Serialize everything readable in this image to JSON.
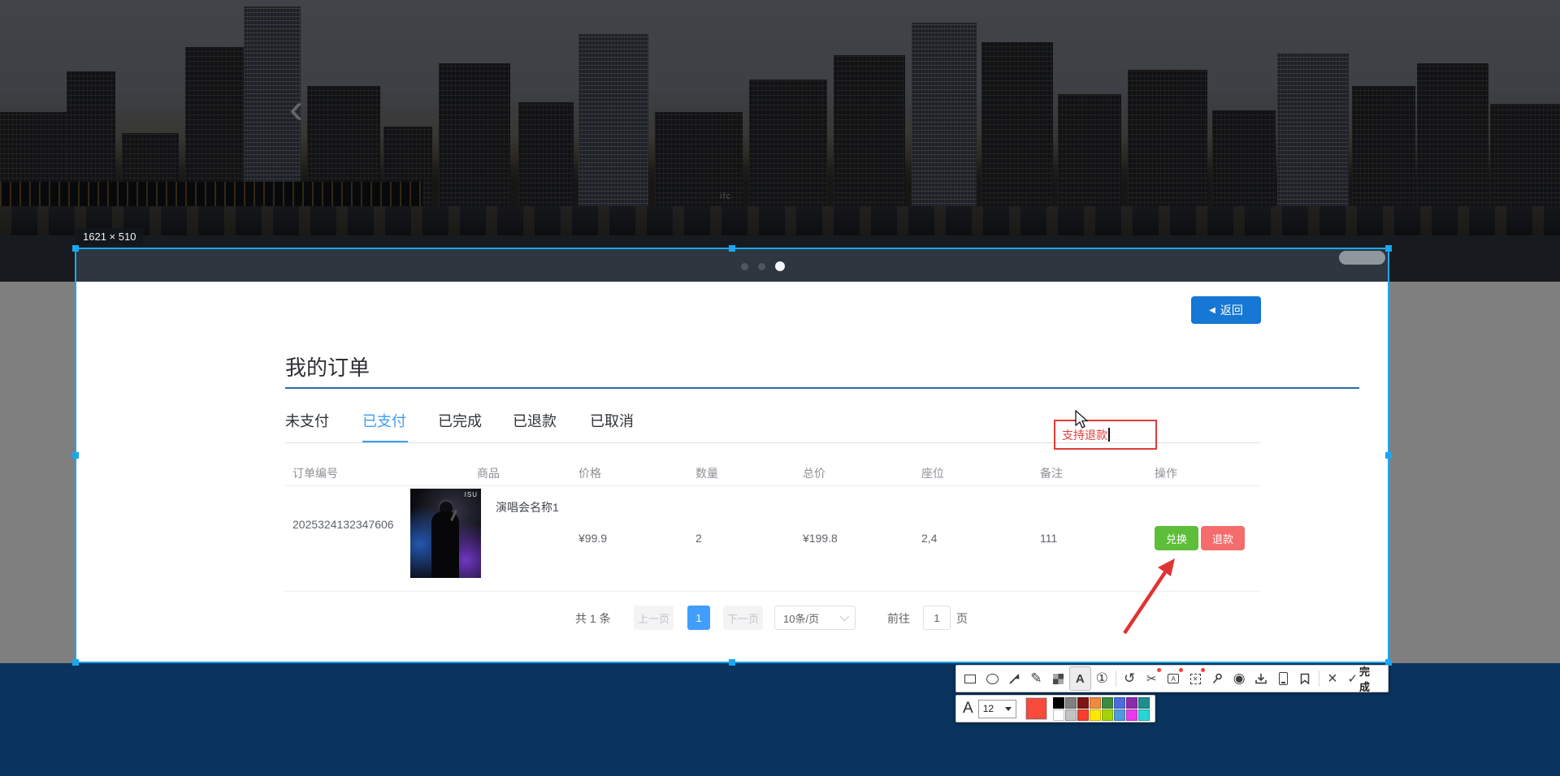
{
  "selection": {
    "size_label": "1621 × 510"
  },
  "carousel": {
    "building_label": "ifc",
    "dot_count": 3,
    "active_dot_index": 2
  },
  "orders": {
    "back_label": "返回",
    "title": "我的订单",
    "tabs": [
      "未支付",
      "已支付",
      "已完成",
      "已退款",
      "已取消"
    ],
    "active_tab": "已支付",
    "table": {
      "headers": [
        "订单编号",
        "商品",
        "价格",
        "数量",
        "总价",
        "座位",
        "备注",
        "操作"
      ],
      "row": {
        "order_no": "2025324132347606",
        "product_name": "演唱会名称1",
        "product_image_text": "ISU",
        "price": "¥99.9",
        "quantity": "2",
        "total": "¥199.8",
        "seats": "2,4",
        "remark": "111",
        "exchange_label": "兑换",
        "refund_label": "退款"
      }
    },
    "pagination": {
      "total": "共 1 条",
      "prev": "上一页",
      "page": "1",
      "next": "下一页",
      "page_size": "10条/页",
      "goto": "前往",
      "goto_value": "1",
      "unit": "页"
    }
  },
  "annotation": {
    "text": "支持退款"
  },
  "tool": {
    "font_letter": "A",
    "font_size": "12",
    "done": "完成",
    "selected_color": "#f84b3c",
    "palette": [
      "#000000",
      "#7f7f7f",
      "#7e1416",
      "#ee8b3e",
      "#3c8b40",
      "#4d6be0",
      "#8d2bad",
      "#1f8e8e",
      "#ffffff",
      "#c3c3c3",
      "#f5402f",
      "#ffe800",
      "#a5d30a",
      "#4f9bdc",
      "#ea3bea",
      "#2bd5d5"
    ],
    "icons": [
      "rectangle-icon",
      "ellipse-icon",
      "arrow-icon",
      "pencil-icon",
      "mosaic-icon",
      "text-icon",
      "step-number-icon",
      "undo-icon",
      "region-ocr-icon",
      "image-ocr-icon",
      "extract-icon",
      "pin-icon",
      "record-icon",
      "download-icon",
      "mobile-icon",
      "bookmark-icon",
      "close-icon",
      "check-icon"
    ]
  },
  "colors": {
    "accent_blue": "#409eff",
    "selection_blue": "#1ba7f0",
    "annotation_red": "#e23c39",
    "button_green": "#5ebe3a",
    "button_red": "#f56c6c",
    "back_blue": "#1677d4",
    "footer_navy": "#1466ba"
  }
}
